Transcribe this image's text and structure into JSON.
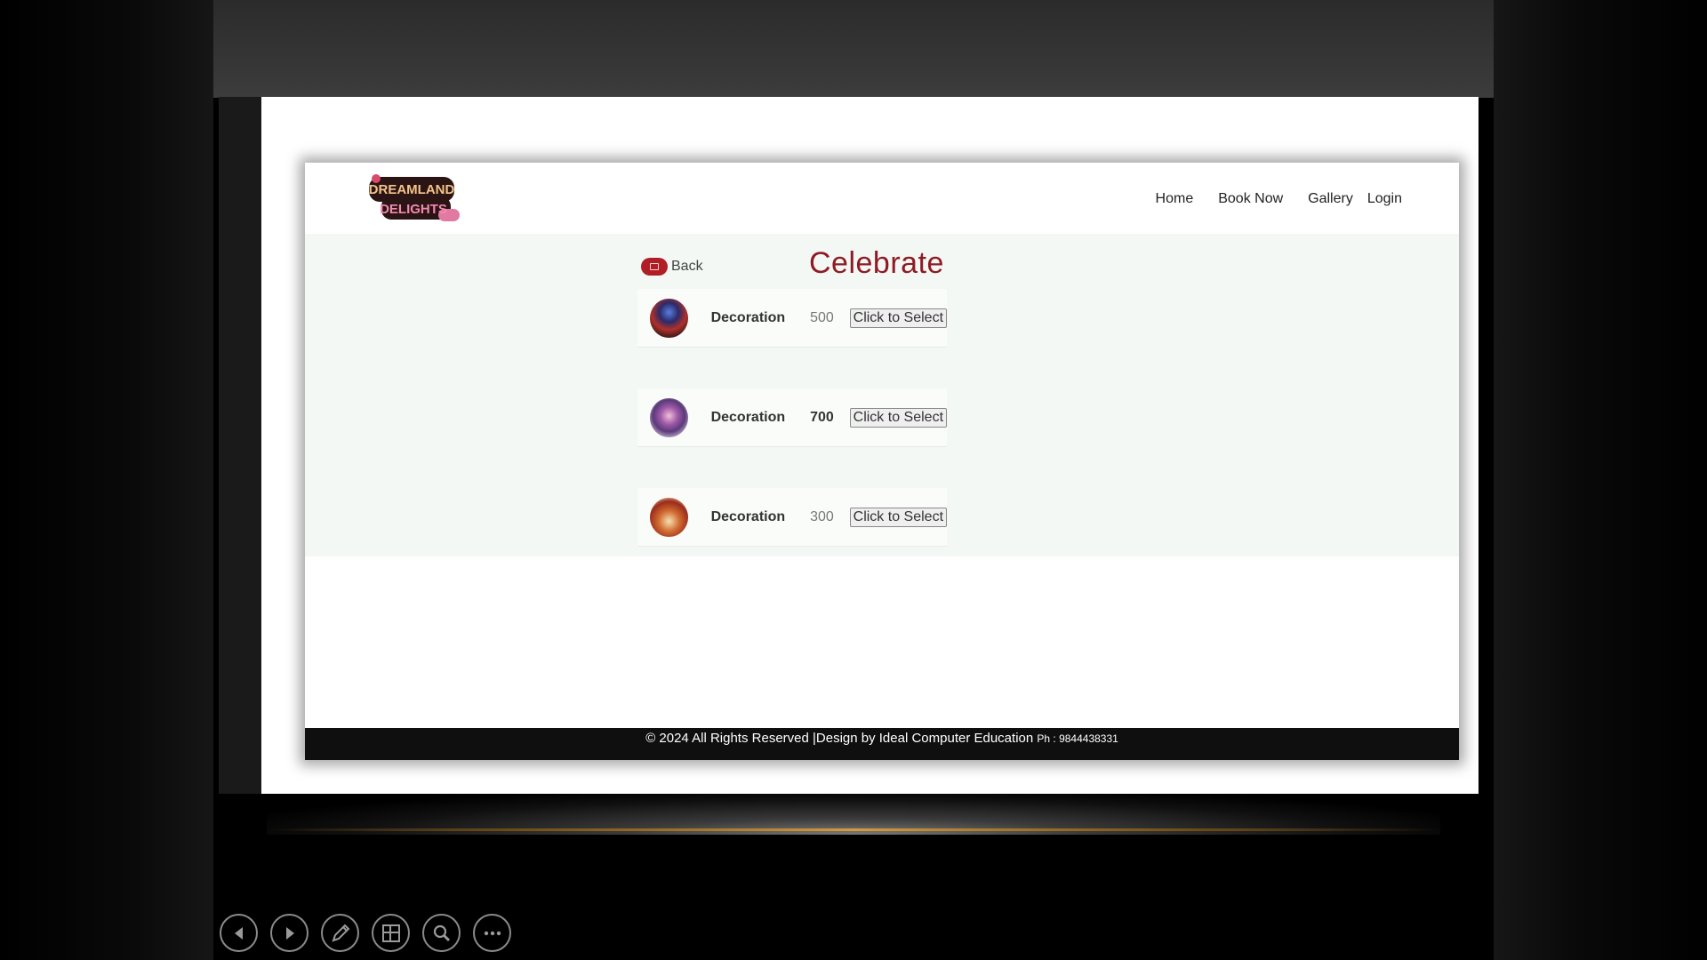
{
  "navbar": {
    "logo_text": "DREAMLAND DELIGHTS",
    "links": [
      "Home",
      "Book Now",
      "Gallery",
      "Login"
    ]
  },
  "page": {
    "back_label": "Back",
    "title": "Celebrate"
  },
  "items": [
    {
      "name": "Decoration",
      "price": "500",
      "button": "Click to Select"
    },
    {
      "name": "Decoration",
      "price": "700",
      "button": "Click to Select"
    },
    {
      "name": "Decoration",
      "price": "300",
      "button": "Click to Select"
    }
  ],
  "footer": {
    "text": "© 2024 All Rights Reserved |Design by Ideal Computer Education",
    "phone": "Ph : 9844438331"
  },
  "colors": {
    "title": "#8e1c24",
    "back_icon": "#b01e26",
    "content_bg": "#f3f8f4",
    "footer_bg": "#0f0f0f"
  },
  "slideshow_controls": [
    "previous-icon",
    "next-icon",
    "pen-icon",
    "slides-icon",
    "zoom-icon",
    "more-icon"
  ]
}
